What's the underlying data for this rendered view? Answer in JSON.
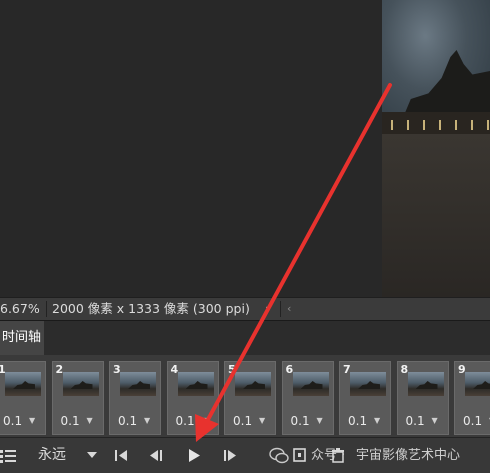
{
  "status_bar": {
    "zoom": "6.67%",
    "doc_info": "2000 像素 x 1333 像素 (300 ppi)",
    "menu_arrow": "›",
    "scroll_arrow": "‹"
  },
  "panel": {
    "tab_label": "时间轴"
  },
  "frames": [
    {
      "number": "1",
      "duration": "0.1"
    },
    {
      "number": "2",
      "duration": "0.1"
    },
    {
      "number": "3",
      "duration": "0.1"
    },
    {
      "number": "4",
      "duration": "0.1"
    },
    {
      "number": "5",
      "duration": "0.1"
    },
    {
      "number": "6",
      "duration": "0.1"
    },
    {
      "number": "7",
      "duration": "0.1"
    },
    {
      "number": "8",
      "duration": "0.1"
    },
    {
      "number": "9",
      "duration": "0.1"
    }
  ],
  "controls": {
    "loop_value": "永远",
    "loop_dropdown_icon": "caret-down-icon",
    "first_frame_icon": "skip-to-first-icon",
    "prev_frame_icon": "step-back-icon",
    "play_icon": "play-icon",
    "next_frame_icon": "step-forward-icon",
    "tween_icon": "tween-icon",
    "new_frame_icon": "new-frame-icon",
    "delete_icon": "trash-icon"
  },
  "watermark": {
    "prefix": "众号 ·",
    "text": "宇宙影像艺术中心"
  },
  "annotation": {
    "arrow_color": "#e8322e"
  }
}
